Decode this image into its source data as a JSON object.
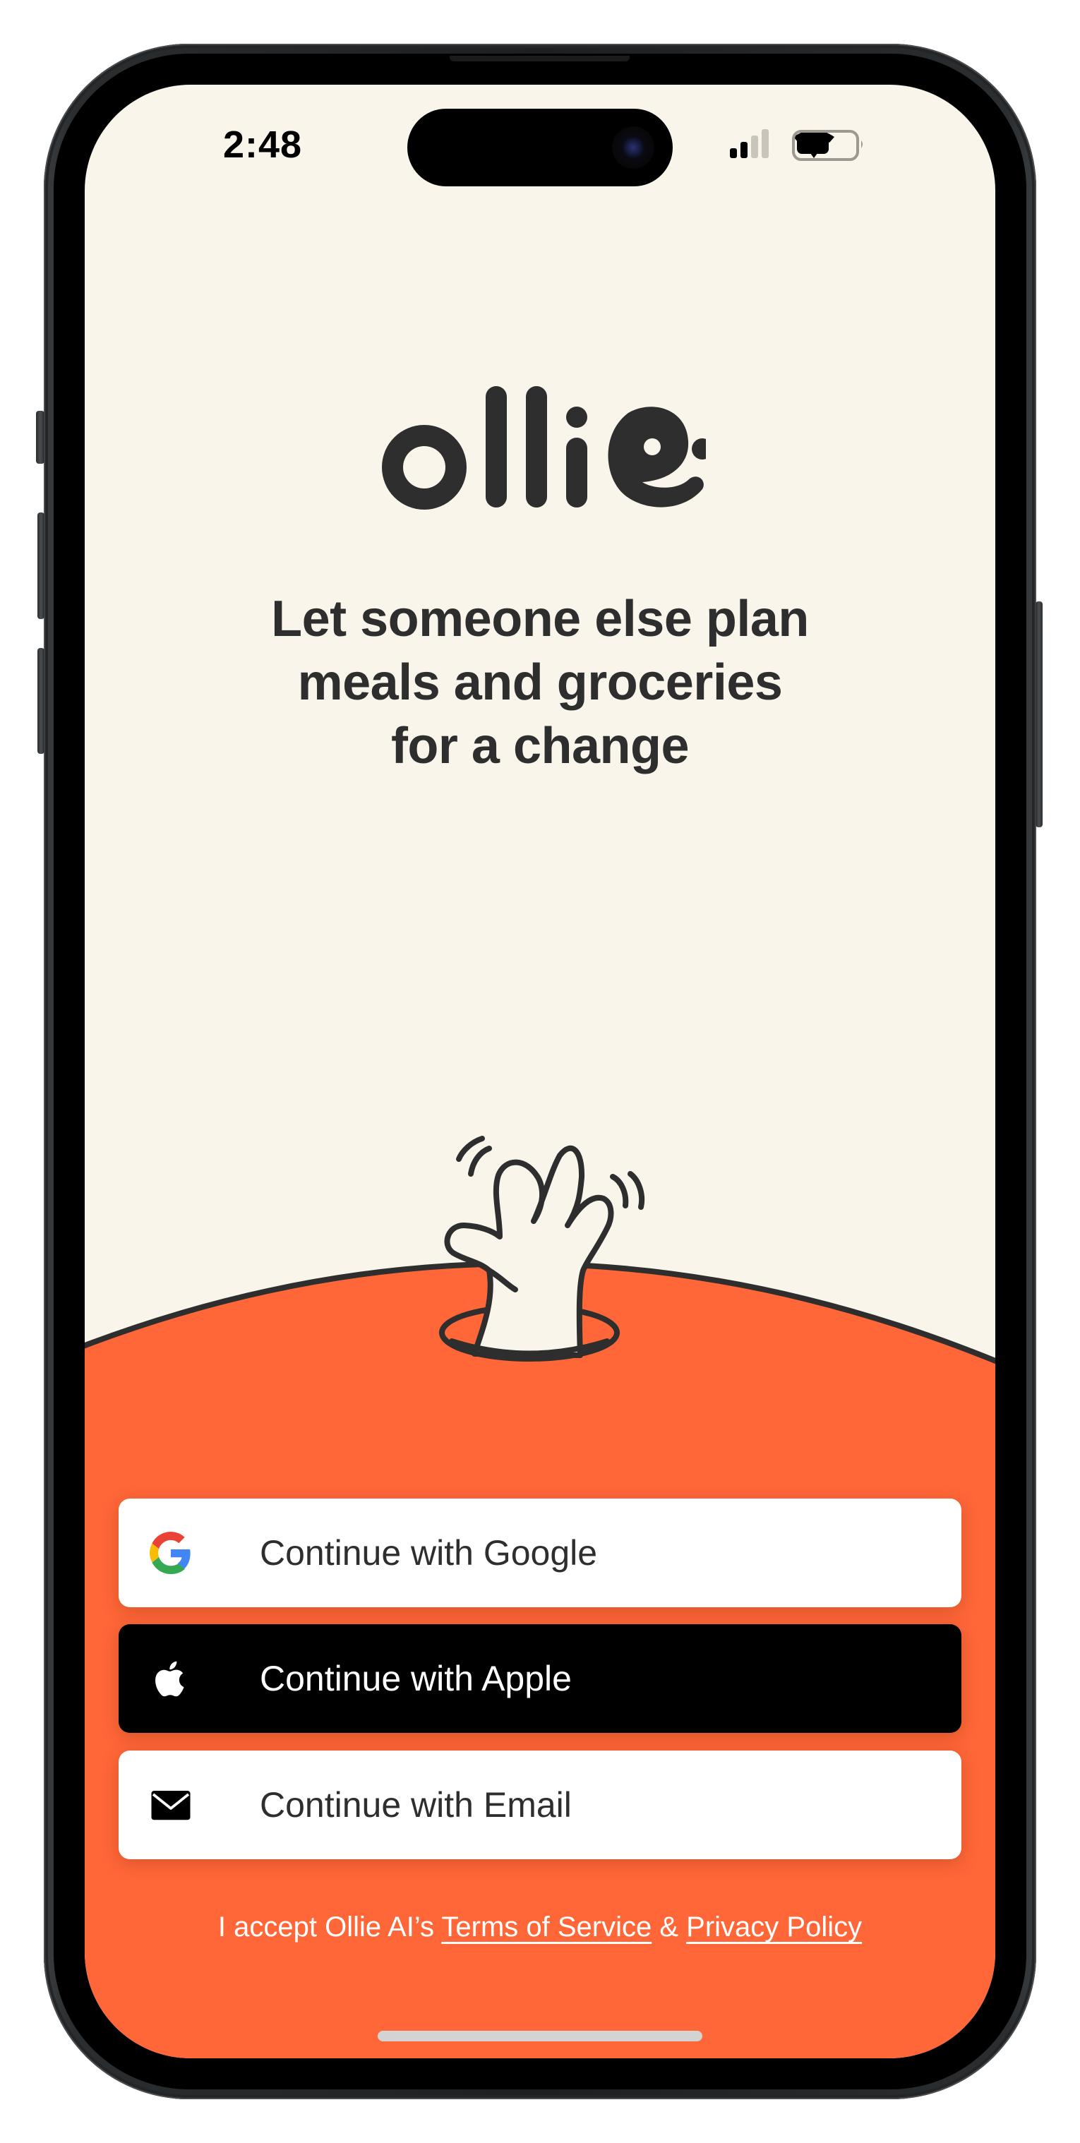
{
  "status_bar": {
    "time": "2:48",
    "signal_bars_active": 2,
    "signal_bars_total": 4,
    "wifi": "wifi-icon",
    "battery_level_percent": 65
  },
  "brand": {
    "logo_text": "ollie",
    "logo_color": "#2e2e2e"
  },
  "headline": {
    "lines": [
      "Let someone else plan",
      "meals and groceries",
      "for a change"
    ]
  },
  "illustration": {
    "description": "waving hand coming out of a hole",
    "icon": "waving-hand-illustration"
  },
  "auth_buttons": [
    {
      "id": "google",
      "label": "Continue with Google",
      "icon": "google-icon"
    },
    {
      "id": "apple",
      "label": "Continue with Apple",
      "icon": "apple-icon"
    },
    {
      "id": "email",
      "label": "Continue with Email",
      "icon": "envelope-icon"
    }
  ],
  "legal": {
    "prefix": "I accept Ollie AI’s ",
    "terms_label": "Terms of Service",
    "separator": " & ",
    "privacy_label": "Privacy Policy"
  },
  "colors": {
    "background_cream": "#f9f5eb",
    "accent_orange": "#ff6738",
    "ink": "#2e2e2e",
    "apple_button": "#000000"
  }
}
